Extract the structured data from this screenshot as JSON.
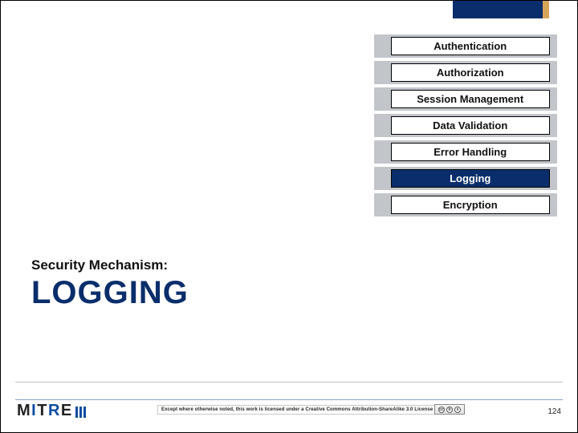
{
  "tabs": {
    "items": [
      {
        "label": "Authentication"
      },
      {
        "label": "Authorization"
      },
      {
        "label": "Session Management"
      },
      {
        "label": "Data Validation"
      },
      {
        "label": "Error Handling"
      },
      {
        "label": "Logging"
      },
      {
        "label": "Encryption"
      }
    ],
    "active_index": 5
  },
  "section": {
    "eyebrow": "Security Mechanism:",
    "title": "LOGGING"
  },
  "footer": {
    "logo_text": "MITRE",
    "license_text": "Except where otherwise noted, this work is licensed under a Creative Commons Attribution-ShareAlike 3.0 License",
    "cc_label": "CC BY-SA",
    "page_number": "124"
  },
  "colors": {
    "brand_navy": "#0a2e6b",
    "brand_blue": "#0a4ea2",
    "accent_tan": "#d7a55a"
  }
}
